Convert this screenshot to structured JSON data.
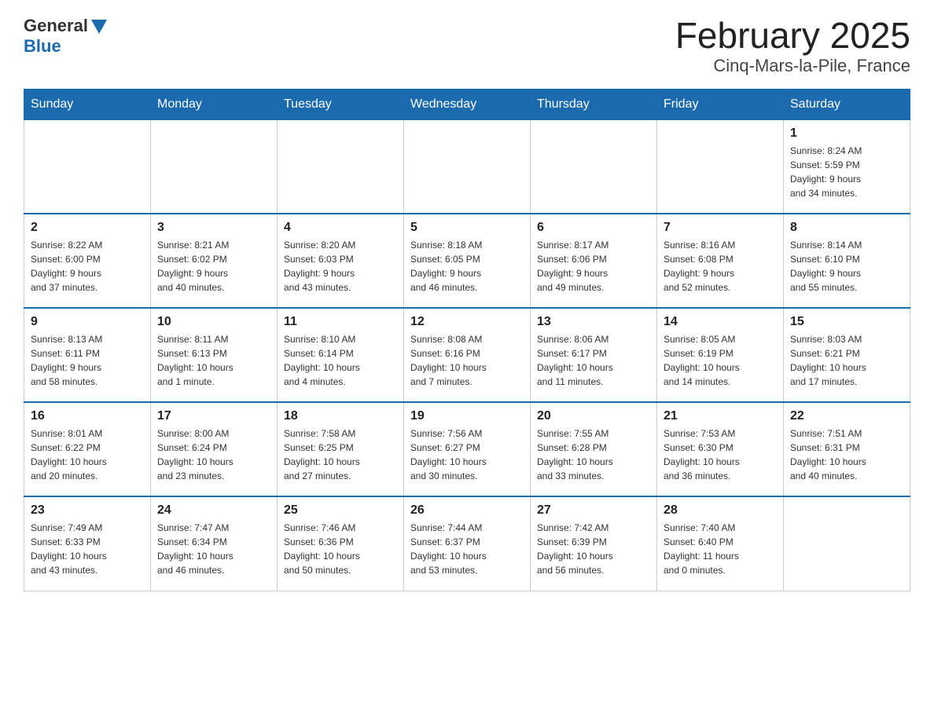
{
  "header": {
    "logo_general": "General",
    "logo_blue": "Blue",
    "title": "February 2025",
    "subtitle": "Cinq-Mars-la-Pile, France"
  },
  "days_of_week": [
    "Sunday",
    "Monday",
    "Tuesday",
    "Wednesday",
    "Thursday",
    "Friday",
    "Saturday"
  ],
  "weeks": [
    {
      "days": [
        {
          "num": "",
          "info": ""
        },
        {
          "num": "",
          "info": ""
        },
        {
          "num": "",
          "info": ""
        },
        {
          "num": "",
          "info": ""
        },
        {
          "num": "",
          "info": ""
        },
        {
          "num": "",
          "info": ""
        },
        {
          "num": "1",
          "info": "Sunrise: 8:24 AM\nSunset: 5:59 PM\nDaylight: 9 hours\nand 34 minutes."
        }
      ]
    },
    {
      "days": [
        {
          "num": "2",
          "info": "Sunrise: 8:22 AM\nSunset: 6:00 PM\nDaylight: 9 hours\nand 37 minutes."
        },
        {
          "num": "3",
          "info": "Sunrise: 8:21 AM\nSunset: 6:02 PM\nDaylight: 9 hours\nand 40 minutes."
        },
        {
          "num": "4",
          "info": "Sunrise: 8:20 AM\nSunset: 6:03 PM\nDaylight: 9 hours\nand 43 minutes."
        },
        {
          "num": "5",
          "info": "Sunrise: 8:18 AM\nSunset: 6:05 PM\nDaylight: 9 hours\nand 46 minutes."
        },
        {
          "num": "6",
          "info": "Sunrise: 8:17 AM\nSunset: 6:06 PM\nDaylight: 9 hours\nand 49 minutes."
        },
        {
          "num": "7",
          "info": "Sunrise: 8:16 AM\nSunset: 6:08 PM\nDaylight: 9 hours\nand 52 minutes."
        },
        {
          "num": "8",
          "info": "Sunrise: 8:14 AM\nSunset: 6:10 PM\nDaylight: 9 hours\nand 55 minutes."
        }
      ]
    },
    {
      "days": [
        {
          "num": "9",
          "info": "Sunrise: 8:13 AM\nSunset: 6:11 PM\nDaylight: 9 hours\nand 58 minutes."
        },
        {
          "num": "10",
          "info": "Sunrise: 8:11 AM\nSunset: 6:13 PM\nDaylight: 10 hours\nand 1 minute."
        },
        {
          "num": "11",
          "info": "Sunrise: 8:10 AM\nSunset: 6:14 PM\nDaylight: 10 hours\nand 4 minutes."
        },
        {
          "num": "12",
          "info": "Sunrise: 8:08 AM\nSunset: 6:16 PM\nDaylight: 10 hours\nand 7 minutes."
        },
        {
          "num": "13",
          "info": "Sunrise: 8:06 AM\nSunset: 6:17 PM\nDaylight: 10 hours\nand 11 minutes."
        },
        {
          "num": "14",
          "info": "Sunrise: 8:05 AM\nSunset: 6:19 PM\nDaylight: 10 hours\nand 14 minutes."
        },
        {
          "num": "15",
          "info": "Sunrise: 8:03 AM\nSunset: 6:21 PM\nDaylight: 10 hours\nand 17 minutes."
        }
      ]
    },
    {
      "days": [
        {
          "num": "16",
          "info": "Sunrise: 8:01 AM\nSunset: 6:22 PM\nDaylight: 10 hours\nand 20 minutes."
        },
        {
          "num": "17",
          "info": "Sunrise: 8:00 AM\nSunset: 6:24 PM\nDaylight: 10 hours\nand 23 minutes."
        },
        {
          "num": "18",
          "info": "Sunrise: 7:58 AM\nSunset: 6:25 PM\nDaylight: 10 hours\nand 27 minutes."
        },
        {
          "num": "19",
          "info": "Sunrise: 7:56 AM\nSunset: 6:27 PM\nDaylight: 10 hours\nand 30 minutes."
        },
        {
          "num": "20",
          "info": "Sunrise: 7:55 AM\nSunset: 6:28 PM\nDaylight: 10 hours\nand 33 minutes."
        },
        {
          "num": "21",
          "info": "Sunrise: 7:53 AM\nSunset: 6:30 PM\nDaylight: 10 hours\nand 36 minutes."
        },
        {
          "num": "22",
          "info": "Sunrise: 7:51 AM\nSunset: 6:31 PM\nDaylight: 10 hours\nand 40 minutes."
        }
      ]
    },
    {
      "days": [
        {
          "num": "23",
          "info": "Sunrise: 7:49 AM\nSunset: 6:33 PM\nDaylight: 10 hours\nand 43 minutes."
        },
        {
          "num": "24",
          "info": "Sunrise: 7:47 AM\nSunset: 6:34 PM\nDaylight: 10 hours\nand 46 minutes."
        },
        {
          "num": "25",
          "info": "Sunrise: 7:46 AM\nSunset: 6:36 PM\nDaylight: 10 hours\nand 50 minutes."
        },
        {
          "num": "26",
          "info": "Sunrise: 7:44 AM\nSunset: 6:37 PM\nDaylight: 10 hours\nand 53 minutes."
        },
        {
          "num": "27",
          "info": "Sunrise: 7:42 AM\nSunset: 6:39 PM\nDaylight: 10 hours\nand 56 minutes."
        },
        {
          "num": "28",
          "info": "Sunrise: 7:40 AM\nSunset: 6:40 PM\nDaylight: 11 hours\nand 0 minutes."
        },
        {
          "num": "",
          "info": ""
        }
      ]
    }
  ]
}
